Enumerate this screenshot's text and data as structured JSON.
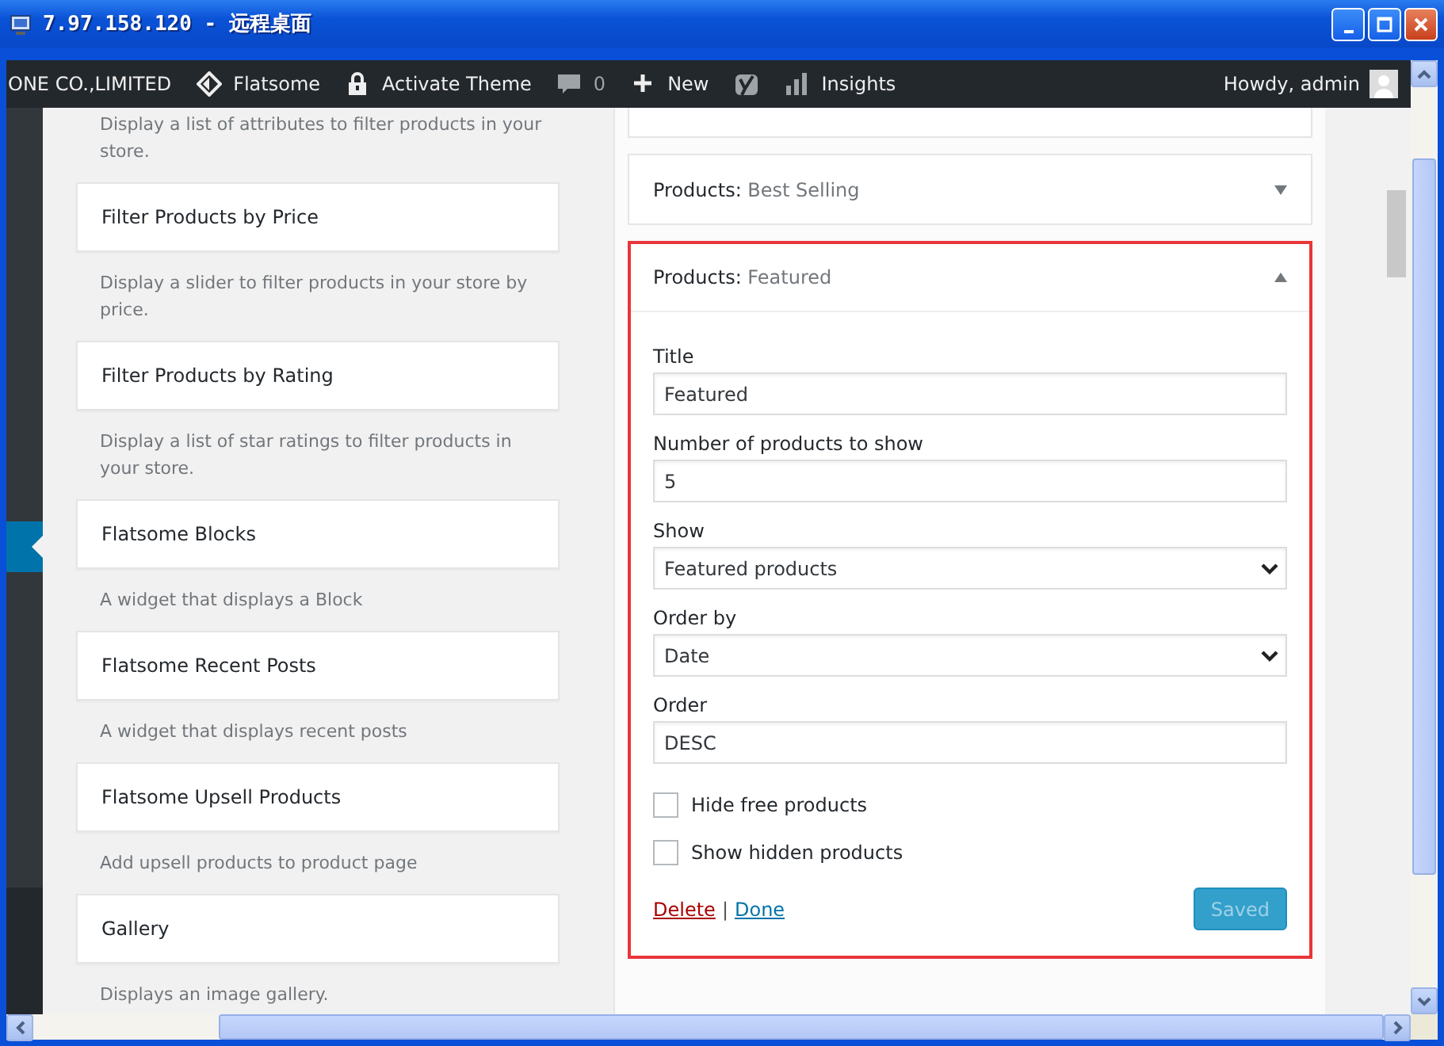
{
  "window": {
    "title": "7.97.158.120 - 远程桌面"
  },
  "admin_bar": {
    "items": [
      {
        "kind": "site",
        "label": "ONE CO.,LIMITED"
      },
      {
        "kind": "flatsome",
        "label": "Flatsome"
      },
      {
        "kind": "lock",
        "label": "Activate Theme"
      },
      {
        "kind": "comments",
        "label": "0"
      },
      {
        "kind": "new",
        "label": "New"
      },
      {
        "kind": "seo"
      },
      {
        "kind": "insights",
        "label": "Insights"
      }
    ],
    "account": "Howdy, admin"
  },
  "available_widgets": [
    {
      "description": "Display a list of attributes to filter products in your store."
    },
    {
      "title": "Filter Products by Price",
      "description": "Display a slider to filter products in your store by price."
    },
    {
      "title": "Filter Products by Rating",
      "description": "Display a list of star ratings to filter products in your store."
    },
    {
      "title": "Flatsome Blocks",
      "description": "A widget that displays a Block"
    },
    {
      "title": "Flatsome Recent Posts",
      "description": "A widget that displays recent posts"
    },
    {
      "title": "Flatsome Upsell Products",
      "description": "Add upsell products to product page"
    },
    {
      "title": "Gallery",
      "description": "Displays an image gallery."
    }
  ],
  "sidebar_widgets": [
    {
      "type": "Products:",
      "name": "Best Selling",
      "expanded": false,
      "highlighted": false
    },
    {
      "type": "Products:",
      "name": "Featured",
      "expanded": true,
      "highlighted": true,
      "fields": [
        {
          "kind": "text",
          "label": "Title",
          "value": "Featured"
        },
        {
          "kind": "text",
          "label": "Number of products to show",
          "value": "5"
        },
        {
          "kind": "select",
          "label": "Show",
          "value": "Featured products"
        },
        {
          "kind": "select",
          "label": "Order by",
          "value": "Date"
        },
        {
          "kind": "text",
          "label": "Order",
          "value": "DESC"
        }
      ],
      "checkboxes": [
        {
          "label": "Hide free products",
          "checked": false
        },
        {
          "label": "Show hidden products",
          "checked": false
        }
      ],
      "delete": "Delete",
      "separator": "|",
      "done": "Done",
      "save": {
        "label": "Saved",
        "disabled": true
      }
    }
  ]
}
